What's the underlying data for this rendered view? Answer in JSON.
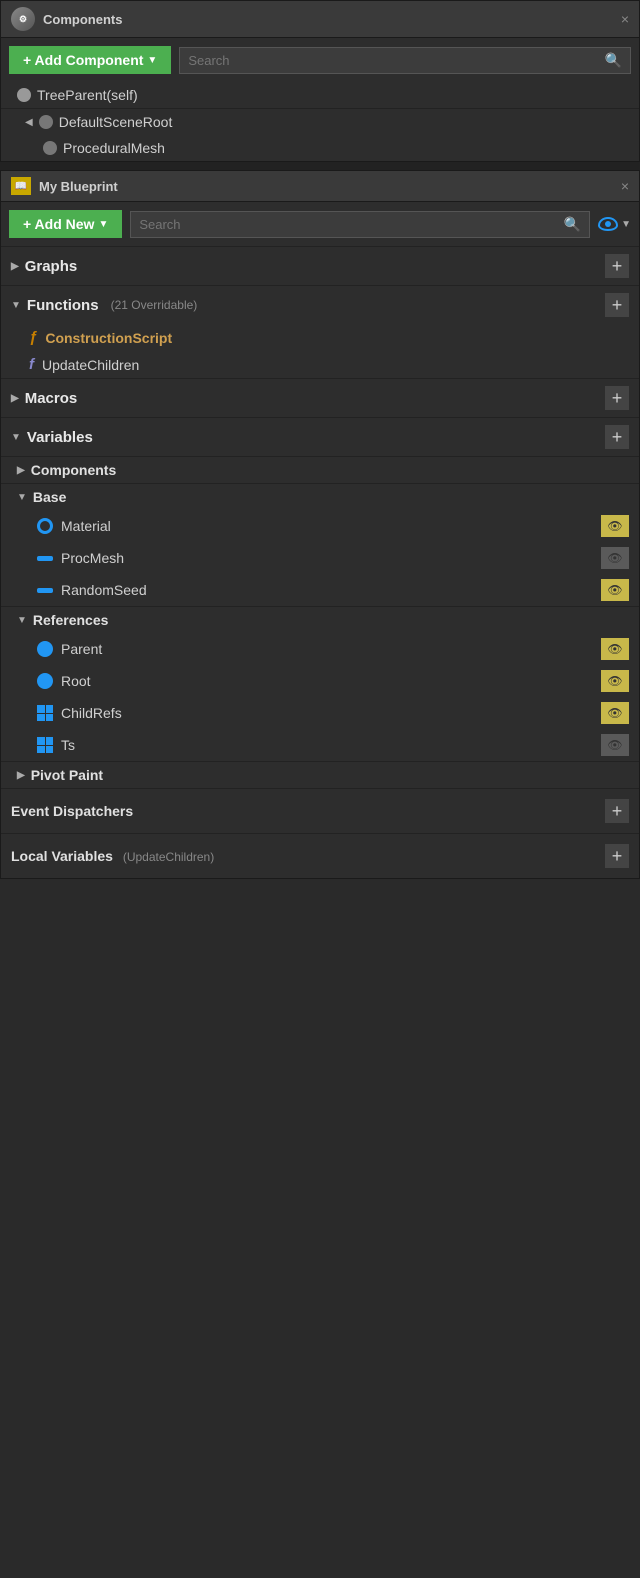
{
  "components_panel": {
    "title": "Components",
    "search_placeholder": "Search",
    "add_button": "+ Add Component",
    "tree": [
      {
        "label": "TreeParent(self)",
        "type": "self",
        "indent": 0
      },
      {
        "label": "DefaultSceneRoot",
        "type": "scene",
        "indent": 1,
        "expanded": true
      },
      {
        "label": "ProceduralMesh",
        "type": "mesh",
        "indent": 2
      }
    ]
  },
  "blueprint_panel": {
    "title": "My Blueprint",
    "add_button": "+ Add New",
    "search_placeholder": "Search",
    "sections": {
      "graphs": {
        "label": "Graphs",
        "expanded": false
      },
      "functions": {
        "label": "Functions",
        "badge": "(21 Overridable)",
        "expanded": true
      },
      "macros": {
        "label": "Macros",
        "expanded": false
      },
      "variables": {
        "label": "Variables",
        "expanded": true
      }
    },
    "functions": [
      {
        "label": "ConstructionScript",
        "special": true
      },
      {
        "label": "UpdateChildren",
        "special": false
      }
    ],
    "variable_groups": {
      "components": {
        "label": "Components"
      },
      "base": {
        "label": "Base",
        "vars": [
          {
            "label": "Material",
            "type": "ring",
            "visible": true
          },
          {
            "label": "ProcMesh",
            "type": "dash",
            "visible": false
          },
          {
            "label": "RandomSeed",
            "type": "dash",
            "visible": true
          }
        ]
      },
      "references": {
        "label": "References",
        "vars": [
          {
            "label": "Parent",
            "type": "solid",
            "visible": true
          },
          {
            "label": "Root",
            "type": "solid",
            "visible": true
          },
          {
            "label": "ChildRefs",
            "type": "grid",
            "visible": true
          },
          {
            "label": "Ts",
            "type": "grid",
            "visible": false
          }
        ]
      },
      "pivot_paint": {
        "label": "Pivot Paint"
      }
    },
    "event_dispatchers": {
      "label": "Event Dispatchers"
    },
    "local_variables": {
      "label": "Local Variables",
      "sub": "(UpdateChildren)"
    }
  },
  "icons": {
    "close": "×",
    "plus": "+",
    "search": "🔍",
    "arrow_right": "▶",
    "arrow_down": "▼",
    "eye": "👁",
    "func_special": "ƒ",
    "func_normal": "f"
  }
}
